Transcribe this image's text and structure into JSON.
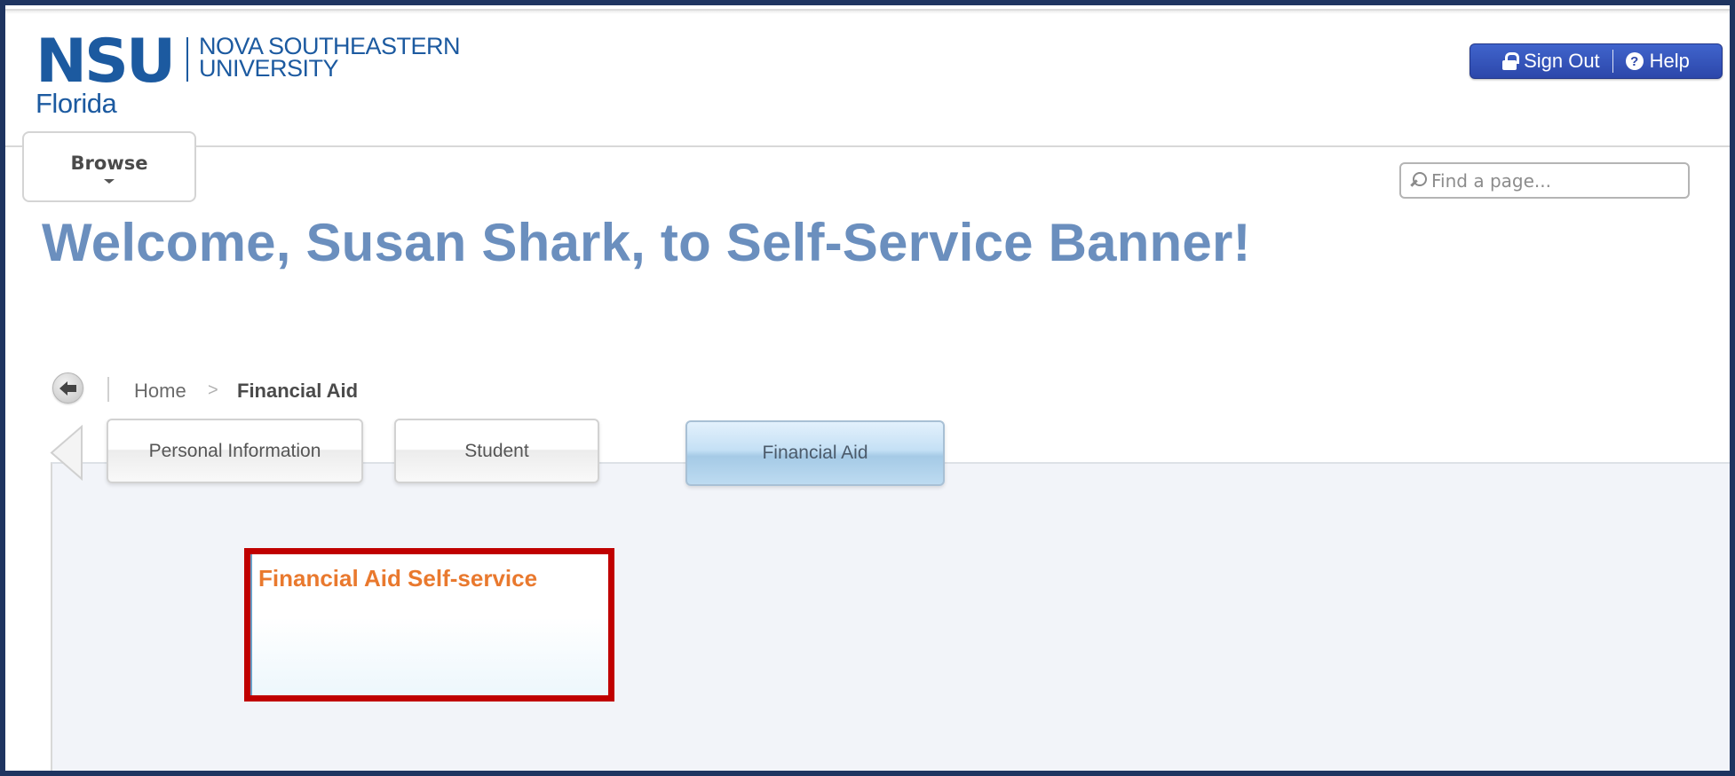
{
  "logo": {
    "abbr": "NSU",
    "name_line1": "NOVA SOUTHEASTERN",
    "name_line2": "UNIVERSITY",
    "location": "Florida",
    "color": "#1c5aa0"
  },
  "header": {
    "sign_out_label": "Sign Out",
    "sign_out_icon": "lock-icon",
    "help_label": "Help",
    "help_icon": "question-circle-icon",
    "help_glyph": "?",
    "browse_label": "Browse",
    "search_placeholder": "Find a page..."
  },
  "welcome": {
    "text": "Welcome, Susan Shark, to Self-Service Banner!",
    "color": "#6b8fbe"
  },
  "breadcrumb": {
    "back_icon": "back-arrow-icon",
    "items": [
      {
        "label": "Home"
      },
      {
        "label": "Financial Aid"
      }
    ],
    "separator": ">"
  },
  "tabs": [
    {
      "label": "Personal Information",
      "active": false
    },
    {
      "label": "Student",
      "active": false
    },
    {
      "label": "Financial Aid",
      "active": true
    }
  ],
  "cards": [
    {
      "title": "Financial Aid Self-service",
      "highlighted": true,
      "title_color": "#e9792e",
      "highlight_color": "#c00000"
    }
  ],
  "colors": {
    "frame": "#1e3460",
    "auth_button": "#2c47aa",
    "panel_bg": "#f2f4f9"
  }
}
